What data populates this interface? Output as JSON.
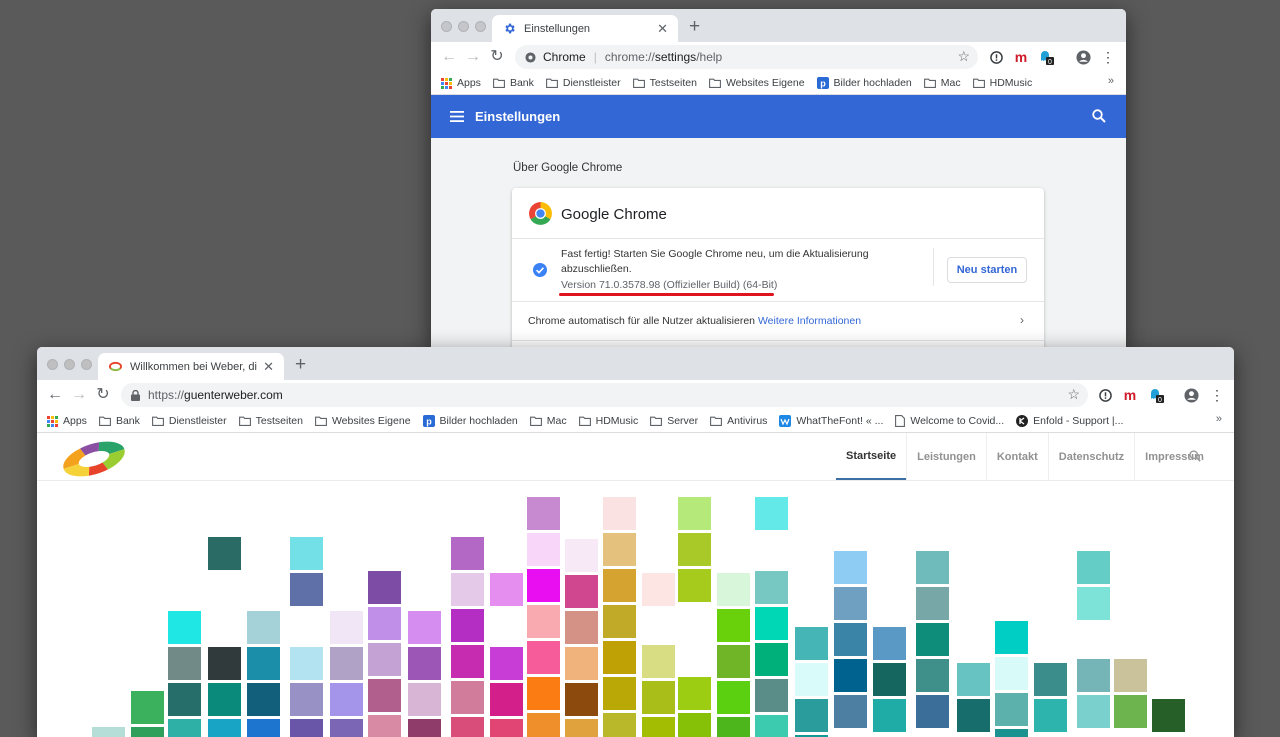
{
  "back_window": {
    "tab_title": "Einstellungen",
    "omnibox": {
      "site": "Chrome",
      "url_prefix": "chrome://",
      "url_bold": "settings",
      "url_suffix": "/help"
    },
    "bookmarks": [
      {
        "label": "Apps",
        "icon": "apps-icon"
      },
      {
        "label": "Bank",
        "icon": "folder-icon"
      },
      {
        "label": "Dienstleister",
        "icon": "folder-icon"
      },
      {
        "label": "Testseiten",
        "icon": "folder-icon"
      },
      {
        "label": "Websites Eigene",
        "icon": "folder-icon"
      },
      {
        "label": "Bilder hochladen",
        "icon": "p-icon"
      },
      {
        "label": "Mac",
        "icon": "folder-icon"
      },
      {
        "label": "HDMusic",
        "icon": "folder-icon"
      }
    ],
    "header_title": "Einstellungen",
    "section_title": "Über Google Chrome",
    "product_name": "Google Chrome",
    "status_line1": "Fast fertig! Starten Sie Google Chrome neu, um die Aktualisierung",
    "status_line2": "abzuschließen.",
    "version": "Version 71.0.3578.98 (Offizieller Build) (64-Bit)",
    "restart_button": "Neu starten",
    "auto_update_text": "Chrome automatisch für alle Nutzer aktualisieren",
    "more_info_link": "Weitere Informationen",
    "ext_badge": "0",
    "colors": {
      "accent": "#3367d6",
      "underline": "#e0141e"
    }
  },
  "front_window": {
    "tab_title": "Willkommen bei Weber, digitale",
    "omnibox": {
      "scheme": "https://",
      "host": "guenterweber.com"
    },
    "bookmarks": [
      {
        "label": "Apps",
        "icon": "apps-icon"
      },
      {
        "label": "Bank",
        "icon": "folder-icon"
      },
      {
        "label": "Dienstleister",
        "icon": "folder-icon"
      },
      {
        "label": "Testseiten",
        "icon": "folder-icon"
      },
      {
        "label": "Websites Eigene",
        "icon": "folder-icon"
      },
      {
        "label": "Bilder hochladen",
        "icon": "p-icon"
      },
      {
        "label": "Mac",
        "icon": "folder-icon"
      },
      {
        "label": "HDMusic",
        "icon": "folder-icon"
      },
      {
        "label": "Server",
        "icon": "folder-icon"
      },
      {
        "label": "Antivirus",
        "icon": "folder-icon"
      },
      {
        "label": "WhatTheFont! « ...",
        "icon": "wtf-icon"
      },
      {
        "label": "Welcome to Covid...",
        "icon": "page-icon"
      },
      {
        "label": "Enfold - Support |...",
        "icon": "k-icon"
      }
    ],
    "menu": [
      "Startseite",
      "Leistungen",
      "Kontakt",
      "Datenschutz",
      "Impressum"
    ],
    "active_menu": "Startseite",
    "ext_badge": "0"
  }
}
